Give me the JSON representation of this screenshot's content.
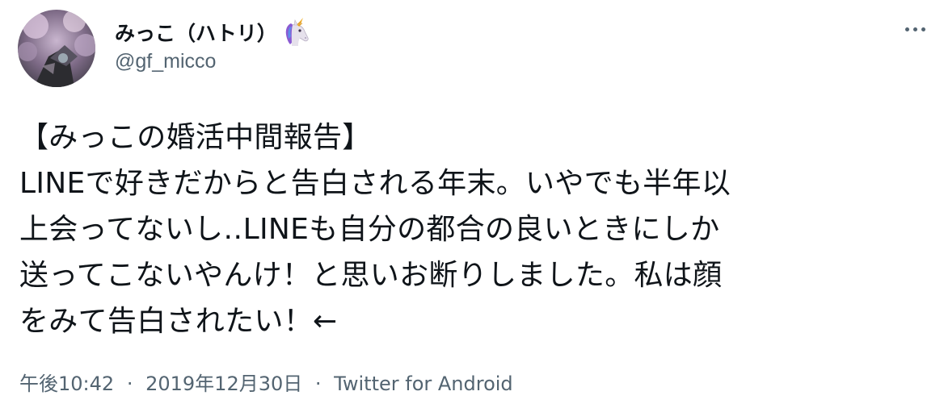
{
  "author": {
    "display_name": "みっこ（ハトリ）",
    "name_emoji": "unicorn-icon",
    "handle": "@gf_micco",
    "avatar": "avatar-photo"
  },
  "more_menu": "more-options-icon",
  "tweet": {
    "lines": [
      "【みっこの婚活中間報告】",
      "LINEで好きだからと告白される年末。いやでも半年以",
      "上会ってないし‥LINEも自分の都合の良いときにしか",
      "送ってこないやんけ！と思いお断りしました。私は顔",
      "をみて告白されたい！←"
    ]
  },
  "meta": {
    "time": "午後10:42",
    "separator": "·",
    "date": "2019年12月30日",
    "source": "Twitter for Android"
  },
  "colors": {
    "text_primary": "#0f1419",
    "text_secondary": "#536471",
    "background": "#ffffff"
  }
}
